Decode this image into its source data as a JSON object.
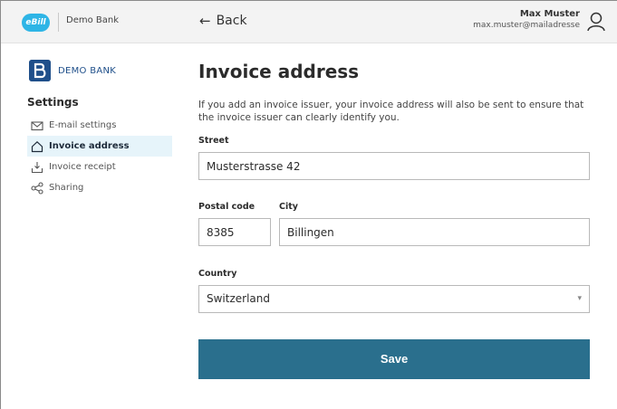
{
  "header": {
    "app_logo_text": "eBill",
    "bank_name": "Demo Bank",
    "back_label": "Back",
    "user_name": "Max Muster",
    "user_email": "max.muster@mailadresse"
  },
  "sidebar": {
    "bank_logo_text": "DEMO BANK",
    "settings_title": "Settings",
    "items": [
      {
        "label": "E-mail settings",
        "icon": "mail-icon",
        "active": false
      },
      {
        "label": "Invoice address",
        "icon": "home-icon",
        "active": true
      },
      {
        "label": "Invoice receipt",
        "icon": "inbox-download-icon",
        "active": false
      },
      {
        "label": "Sharing",
        "icon": "share-icon",
        "active": false
      }
    ]
  },
  "main": {
    "title": "Invoice address",
    "intro": "If you add an invoice issuer, your invoice address will also be sent to ensure that the invoice issuer can clearly identify you.",
    "street": {
      "label": "Street",
      "value": "Musterstrasse 42"
    },
    "postal_code": {
      "label": "Postal code",
      "value": "8385"
    },
    "city": {
      "label": "City",
      "value": "Billingen"
    },
    "country": {
      "label": "Country",
      "value": "Switzerland"
    },
    "save_label": "Save"
  },
  "colors": {
    "accent": "#2a6f8d",
    "ebill_blue": "#2eb5e6",
    "active_menu_bg": "#e6f4fa",
    "bank_blue": "#1f4f8a"
  }
}
